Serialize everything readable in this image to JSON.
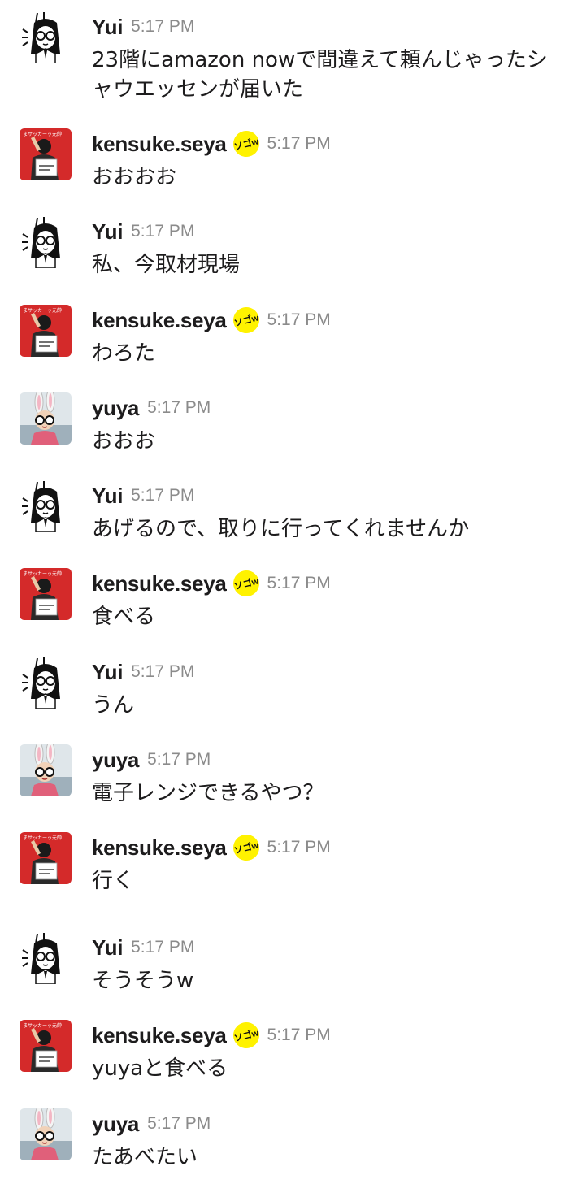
{
  "users": {
    "yui": {
      "name": "Yui"
    },
    "kensuke": {
      "name": "kensuke.seya",
      "status_emoji": "ソゴw",
      "avatar_caption": "まサッカーッ元帥"
    },
    "yuya": {
      "name": "yuya"
    }
  },
  "messages": [
    {
      "user": "Yui",
      "avatar": "yui",
      "time": "5:17 PM",
      "text": "23階にamazon nowで間違えて頼んじゃったシャウエッセンが届いた"
    },
    {
      "user": "kensuke.seya",
      "avatar": "kensuke",
      "badge": "ソゴw",
      "time": "5:17 PM",
      "text": "おおおお"
    },
    {
      "user": "Yui",
      "avatar": "yui",
      "time": "5:17 PM",
      "text": "私、今取材現場"
    },
    {
      "user": "kensuke.seya",
      "avatar": "kensuke",
      "badge": "ソゴw",
      "time": "5:17 PM",
      "text": "わろた"
    },
    {
      "user": "yuya",
      "avatar": "yuya",
      "time": "5:17 PM",
      "text": "おおお"
    },
    {
      "user": "Yui",
      "avatar": "yui",
      "time": "5:17 PM",
      "text": "あげるので、取りに行ってくれませんか"
    },
    {
      "user": "kensuke.seya",
      "avatar": "kensuke",
      "badge": "ソゴw",
      "time": "5:17 PM",
      "text": "食べる"
    },
    {
      "user": "Yui",
      "avatar": "yui",
      "time": "5:17 PM",
      "text": "うん"
    },
    {
      "user": "yuya",
      "avatar": "yuya",
      "time": "5:17 PM",
      "text": "電子レンジできるやつ？"
    },
    {
      "user": "kensuke.seya",
      "avatar": "kensuke",
      "badge": "ソゴw",
      "time": "5:17 PM",
      "text": "行く"
    },
    {
      "user": "Yui",
      "avatar": "yui",
      "time": "5:17 PM",
      "text": "そうそうw"
    },
    {
      "user": "kensuke.seya",
      "avatar": "kensuke",
      "badge": "ソゴw",
      "time": "5:17 PM",
      "text": "yuyaと食べる"
    },
    {
      "user": "yuya",
      "avatar": "yuya",
      "time": "5:17 PM",
      "text": "たあべたい"
    }
  ]
}
